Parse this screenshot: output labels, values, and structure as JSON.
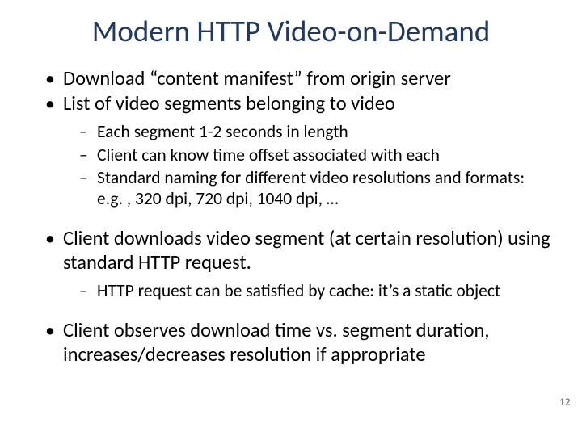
{
  "title_color": "#1F3864",
  "title": "Modern HTTP Video-on-Demand",
  "bullets": [
    {
      "text": "Download “content manifest” from origin server",
      "sub": []
    },
    {
      "text": "List of video segments belonging to video",
      "sub": [
        "Each segment 1-2 seconds in length",
        "Client can know time offset associated with each",
        "Standard naming for different video resolutions and formats: e.g. , 320 dpi, 720 dpi, 1040 dpi, …"
      ]
    },
    {
      "text": "Client downloads video segment (at certain resolution) using standard HTTP request.",
      "sub": [
        "HTTP request can be satisfied by cache:  it’s a static object"
      ]
    },
    {
      "text": "Client observes download time vs. segment duration, increases/decreases resolution if appropriate",
      "sub": []
    }
  ],
  "page_number": "12"
}
